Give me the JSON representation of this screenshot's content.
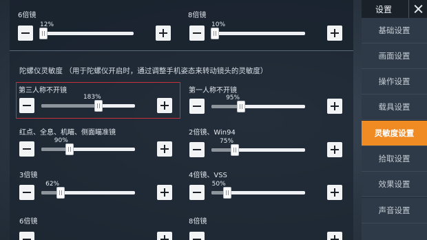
{
  "sidebar": {
    "title": "设置",
    "items": [
      {
        "label": "基础设置",
        "active": false
      },
      {
        "label": "画面设置",
        "active": false
      },
      {
        "label": "操作设置",
        "active": false
      },
      {
        "label": "载具设置",
        "active": false
      },
      {
        "label": "灵敏度设置",
        "active": true
      },
      {
        "label": "拾取设置",
        "active": false
      },
      {
        "label": "效果设置",
        "active": false
      },
      {
        "label": "声音设置",
        "active": false
      }
    ]
  },
  "top_controls": [
    {
      "label": "6倍镜",
      "percent_text": "12%",
      "value": 12
    },
    {
      "label": "8倍镜",
      "percent_text": "10%",
      "value": 10
    }
  ],
  "gyro_section": {
    "title": "陀螺仪灵敏度 （用于陀螺仪开启时，通过调整手机姿态来转动镜头的灵敏度）",
    "controls": [
      {
        "label": "第三人称不开镜",
        "percent_text": "183%",
        "value": 183,
        "highlighted": true
      },
      {
        "label": "第一人称不开镜",
        "percent_text": "95%",
        "value": 95
      },
      {
        "label": "红点、全息、机瞄、侧面瞄准镜",
        "percent_text": "90%",
        "value": 90
      },
      {
        "label": "2倍镜、Win94",
        "percent_text": "75%",
        "value": 75
      },
      {
        "label": "3倍镜",
        "percent_text": "62%",
        "value": 62
      },
      {
        "label": "4倍镜、VSS",
        "percent_text": "50%",
        "value": 50
      }
    ],
    "bottom_labels": [
      "6倍镜",
      "8倍镜"
    ]
  },
  "slider_max": 300,
  "colors": {
    "accent": "#f08a22",
    "highlight_border": "#c8303a"
  }
}
